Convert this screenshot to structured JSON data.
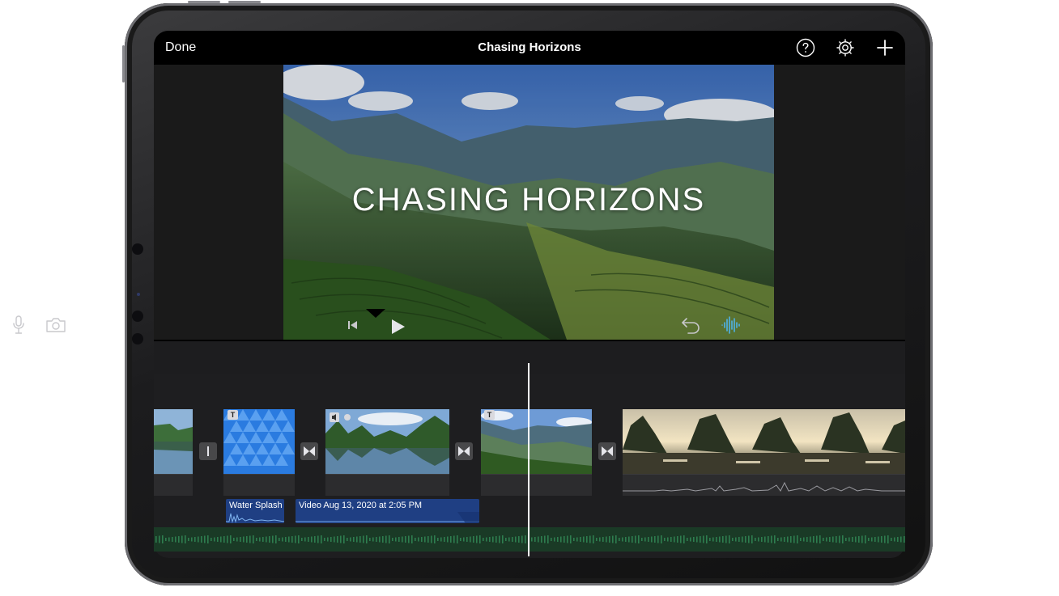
{
  "app": {
    "title": "Chasing Horizons",
    "done_label": "Done"
  },
  "topbar_icons": [
    "help-icon",
    "gear-icon",
    "add-icon"
  ],
  "viewer": {
    "title_overlay": "CHASING HORIZONS"
  },
  "controls": {
    "left_icons": [
      "mic-icon",
      "camera-icon"
    ],
    "center_icons": [
      "skip-back-icon",
      "play-icon"
    ],
    "right_icons": [
      "undo-icon",
      "audio-waveform-icon"
    ],
    "accent_color": "#4fb3e8"
  },
  "timeline": {
    "audio_clips": [
      {
        "label": "Water Splash"
      },
      {
        "label": "Video Aug 13, 2020 at 2:05 PM"
      }
    ],
    "title_badge": "T",
    "transition_icons": [
      "cut-transition-icon",
      "cross-dissolve-icon",
      "cross-dissolve-icon",
      "cross-dissolve-icon"
    ],
    "colors": {
      "audio_clip": "#1f3f83",
      "background_music": "#2e7d4f",
      "title_clip": "#2a7be0"
    }
  }
}
